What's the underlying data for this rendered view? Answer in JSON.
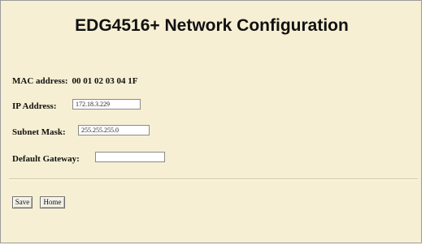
{
  "page": {
    "title": "EDG4516+ Network Configuration"
  },
  "mac": {
    "label": "MAC address:",
    "value": "00 01 02 03 04 1F"
  },
  "ip": {
    "label": "IP Address:",
    "value": "172.18.3.229"
  },
  "subnet": {
    "label": "Subnet Mask:",
    "value": "255.255.255.0"
  },
  "gateway": {
    "label": "Default Gateway:",
    "value": ""
  },
  "buttons": {
    "save": "Save",
    "home": "Home"
  },
  "colors": {
    "background": "#f6efd3"
  }
}
